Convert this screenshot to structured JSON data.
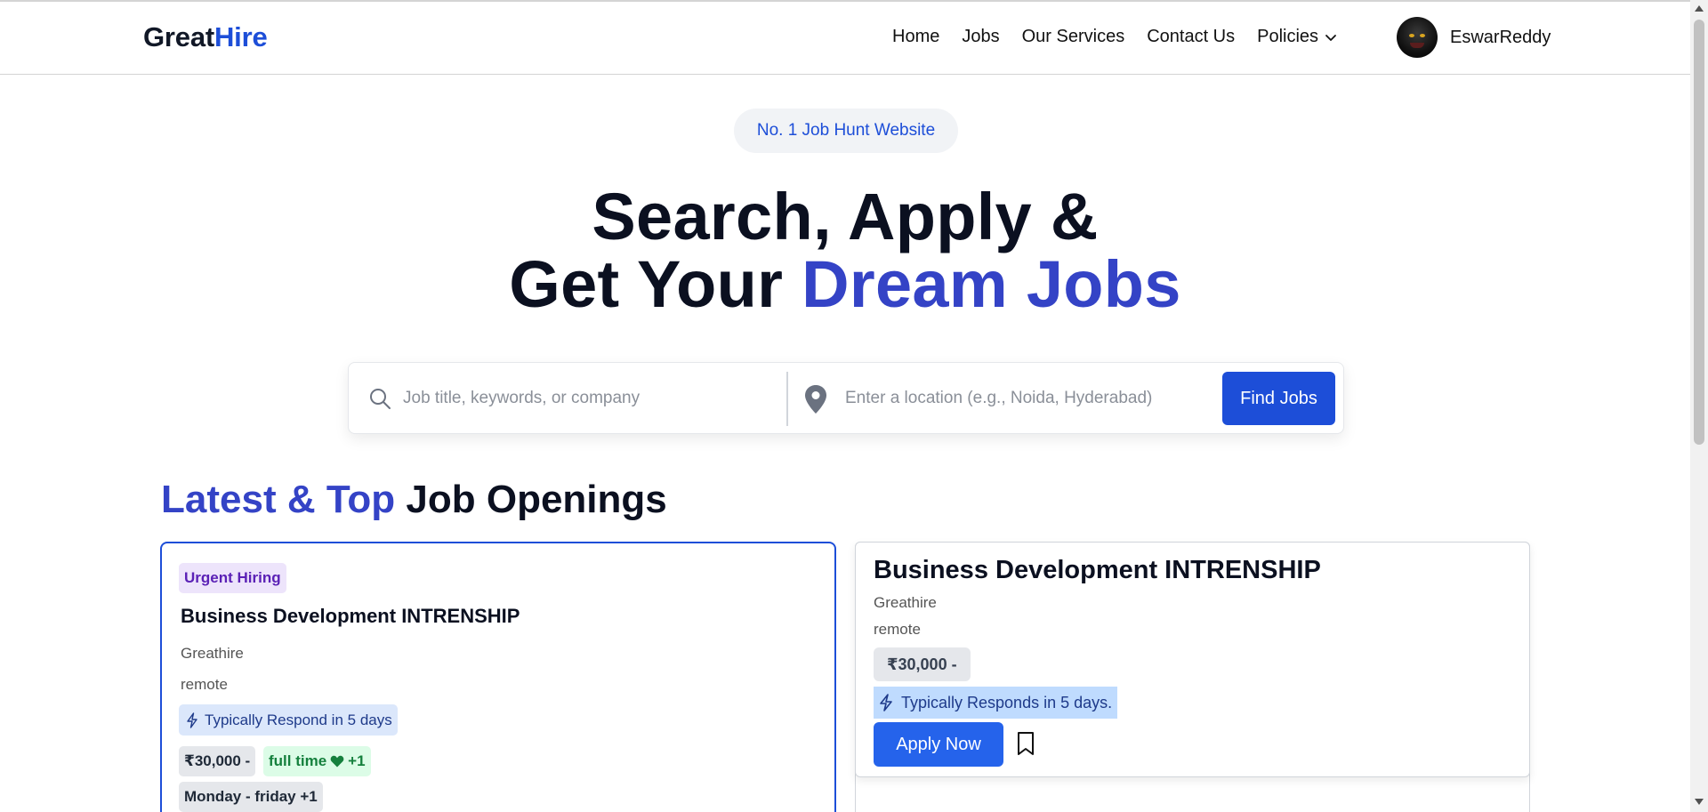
{
  "brand": {
    "part1": "Great",
    "part2": "Hire"
  },
  "nav": {
    "items": [
      "Home",
      "Jobs",
      "Our Services",
      "Contact Us"
    ],
    "policies": "Policies",
    "username": "EswarReddy"
  },
  "hero": {
    "badge": "No. 1 Job Hunt Website",
    "line1": "Search, Apply &",
    "line2_prefix": "Get Your ",
    "line2_highlight": "Dream Jobs"
  },
  "search": {
    "query_placeholder": "Job title, keywords, or company",
    "location_placeholder": "Enter a location (e.g., Noida, Hyderabad)",
    "button": "Find Jobs"
  },
  "section": {
    "title_highlight": "Latest & Top",
    "title_rest": " Job Openings"
  },
  "cards": [
    {
      "tag": "Urgent Hiring",
      "title": "Business Development INTRENSHIP",
      "company": "Greathire",
      "location": "remote",
      "respond": "Typically Respond in 5 days",
      "salary": "₹30,000 -",
      "job_type": "full time",
      "job_type_extra": "+1",
      "schedule": "Monday - friday +1"
    },
    {
      "title": "Business Development INTRENSHIP",
      "company": "Greathire",
      "location": "remote",
      "salary": "₹30,000 -",
      "respond": "Typically Responds in 5 days.",
      "apply": "Apply Now"
    }
  ],
  "colors": {
    "accent": "#1d4ed8",
    "heading_blue": "#3443c6",
    "urgent_bg": "#ede4fb",
    "green": "#15803d"
  }
}
